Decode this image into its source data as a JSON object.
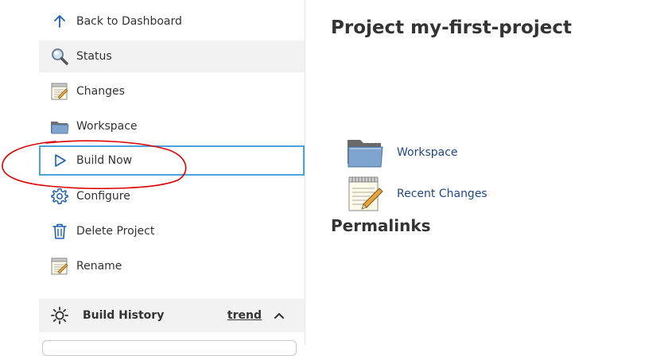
{
  "sidebar": {
    "items": [
      {
        "id": "back",
        "label": "Back to Dashboard",
        "icon": "arrow-up-icon"
      },
      {
        "id": "status",
        "label": "Status",
        "icon": "magnifier-icon"
      },
      {
        "id": "changes",
        "label": "Changes",
        "icon": "notepad-icon"
      },
      {
        "id": "workspace",
        "label": "Workspace",
        "icon": "folder-icon"
      },
      {
        "id": "build-now",
        "label": "Build Now",
        "icon": "play-icon"
      },
      {
        "id": "configure",
        "label": "Configure",
        "icon": "gear-icon"
      },
      {
        "id": "delete",
        "label": "Delete Project",
        "icon": "trash-icon"
      },
      {
        "id": "rename",
        "label": "Rename",
        "icon": "notepad-icon"
      }
    ],
    "build_history": {
      "title": "Build History",
      "trend_label": "trend",
      "icon": "build-history-icon"
    }
  },
  "main": {
    "title": "Project my-first-project",
    "links": [
      {
        "label": "Workspace",
        "icon": "folder-icon"
      },
      {
        "label": "Recent Changes",
        "icon": "notepad-icon"
      }
    ],
    "permalinks_title": "Permalinks"
  },
  "colors": {
    "link": "#204a87",
    "focus_border": "#4aa3df",
    "active_bg": "#f2f2f2",
    "annotation": "#e00000"
  }
}
